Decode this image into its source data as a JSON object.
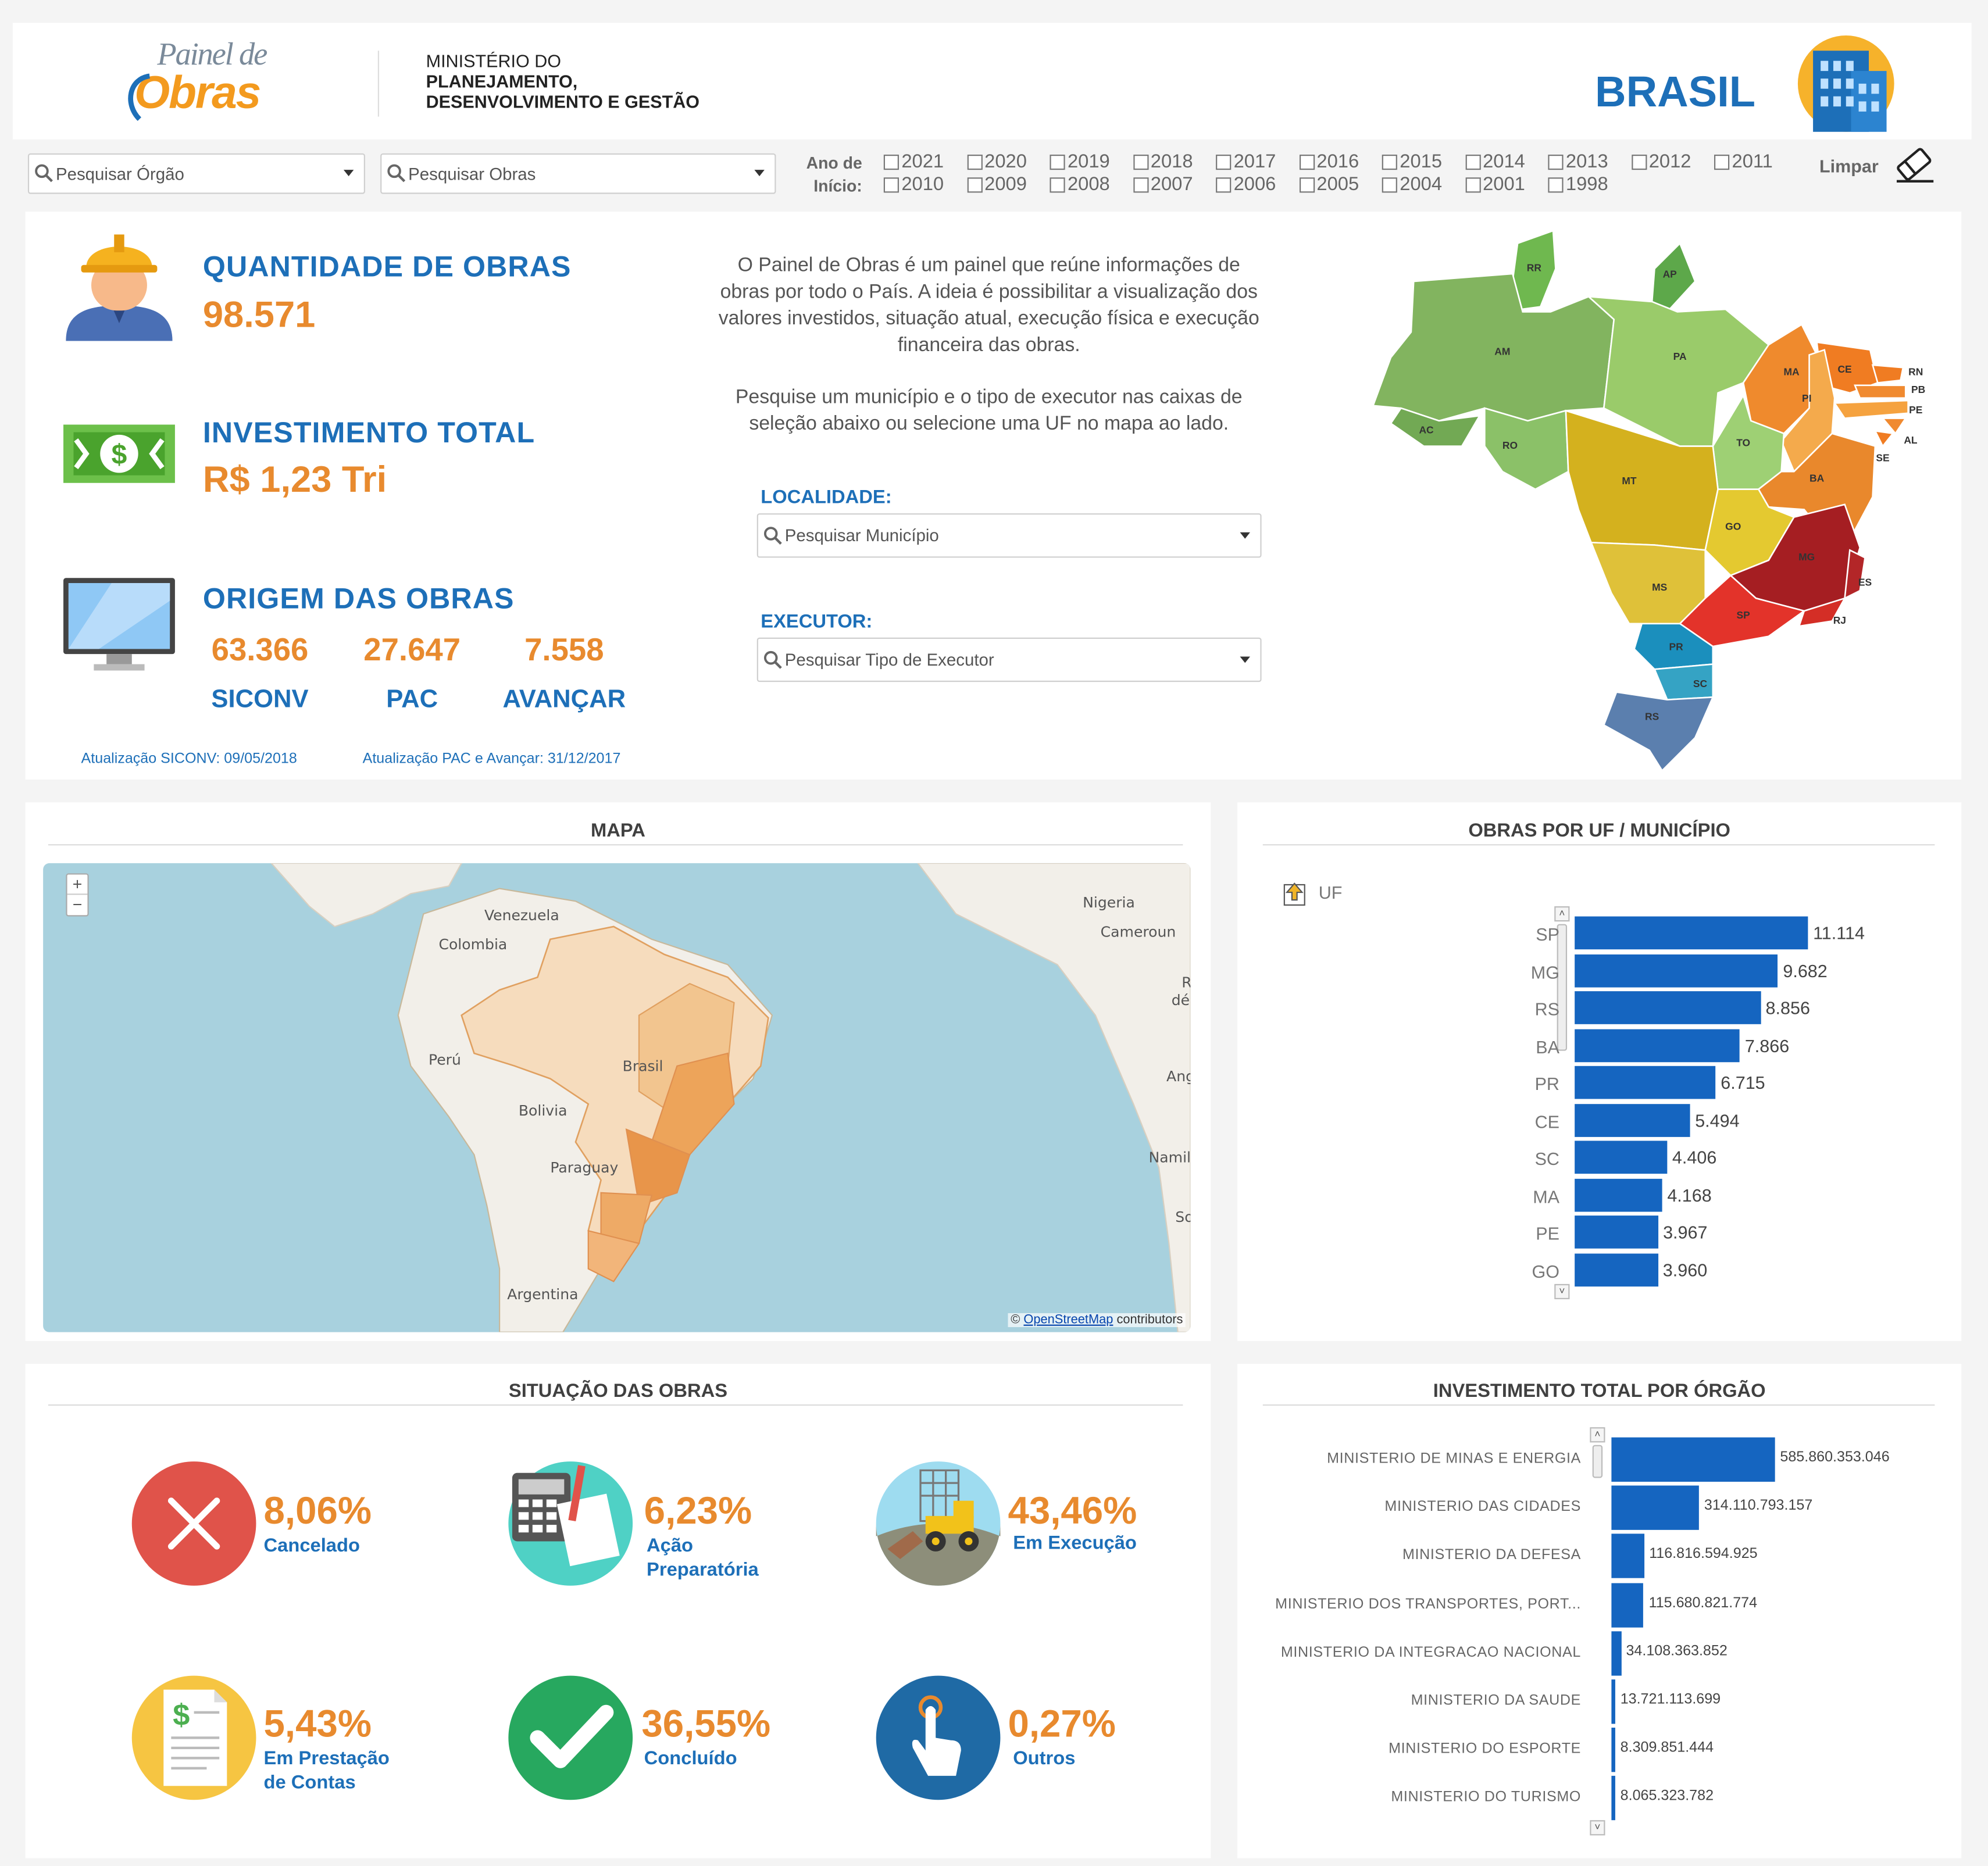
{
  "header": {
    "logo_line1": "Painel de",
    "logo_line2": "Obras",
    "ministry_line1": "MINISTÉRIO DO",
    "ministry_line2": "PLANEJAMENTO,",
    "ministry_line3": "DESENVOLVIMENTO E GESTÃO",
    "country": "BRASIL",
    "icon": "building-icon"
  },
  "filters": {
    "orgao_placeholder": "Pesquisar Órgão",
    "obras_placeholder": "Pesquisar Obras",
    "ano_label_1": "Ano de",
    "ano_label_2": "Início:",
    "years_row1": [
      "2021",
      "2020",
      "2019",
      "2018",
      "2017",
      "2016",
      "2015",
      "2014",
      "2013",
      "2012",
      "2011"
    ],
    "years_row2": [
      "2010",
      "2009",
      "2008",
      "2007",
      "2006",
      "2005",
      "2004",
      "2001",
      "1998"
    ],
    "clear_label": "Limpar"
  },
  "kpis": {
    "quantidade_title": "QUANTIDADE DE OBRAS",
    "quantidade_value": "98.571",
    "investimento_title": "INVESTIMENTO TOTAL",
    "investimento_value": "R$ 1,23 Tri",
    "origem_title": "ORIGEM DAS OBRAS",
    "origem": [
      {
        "value": "63.366",
        "label": "SICONV"
      },
      {
        "value": "27.647",
        "label": "PAC"
      },
      {
        "value": "7.558",
        "label": "AVANÇAR"
      }
    ],
    "update_siconv": "Atualização SICONV: 09/05/2018",
    "update_pac": "Atualização PAC e Avançar: 31/12/2017"
  },
  "intro": {
    "p1_l1": "O Painel de Obras é um painel que reúne informações de",
    "p1_l2": "obras por todo o País. A ideia é possibilitar a visualização dos",
    "p1_l3": "valores investidos, situação atual, execução física e execução",
    "p1_l4": "financeira das obras.",
    "p2_l1": "Pesquise um município e o tipo de executor nas caixas de",
    "p2_l2": "seleção abaixo ou selecione uma UF no mapa ao lado.",
    "localidade_label": "LOCALIDADE:",
    "localidade_placeholder": "Pesquisar Município",
    "executor_label": "EXECUTOR:",
    "executor_placeholder": "Pesquisar Tipo de Executor"
  },
  "uf_map": {
    "codes": [
      "RR",
      "AP",
      "AM",
      "PA",
      "MA",
      "CE",
      "RN",
      "PB",
      "PE",
      "AL",
      "SE",
      "PI",
      "AC",
      "RO",
      "TO",
      "MT",
      "BA",
      "GO",
      "MG",
      "ES",
      "MS",
      "SP",
      "RJ",
      "PR",
      "SC",
      "RS"
    ]
  },
  "mapa": {
    "title": "MAPA",
    "zoom_in": "+",
    "zoom_out": "−",
    "labels": [
      "Venezuela",
      "Colombia",
      "Nigeria",
      "Cameroun",
      "Perú",
      "Brasil",
      "Bolivia",
      "Paraguay",
      "Argentina",
      "Ang",
      "Namil",
      "dé",
      "So",
      "R"
    ],
    "attribution_prefix": "©",
    "attribution_link": "OpenStreetMap",
    "attribution_suffix": "contributors"
  },
  "obras_uf": {
    "title": "OBRAS POR UF / MUNICÍPIO",
    "drill_label": "UF"
  },
  "situacao": {
    "title": "SITUAÇÃO DAS OBRAS",
    "items": [
      {
        "pct": "8,06%",
        "label1": "Cancelado",
        "label2": "",
        "icon": "cancel-icon"
      },
      {
        "pct": "6,23%",
        "label1": "Ação",
        "label2": "Preparatória",
        "icon": "calculator-icon"
      },
      {
        "pct": "43,46%",
        "label1": "Em Execução",
        "label2": "",
        "icon": "construction-icon"
      },
      {
        "pct": "5,43%",
        "label1": "Em Prestação",
        "label2": "de Contas",
        "icon": "invoice-icon"
      },
      {
        "pct": "36,55%",
        "label1": "Concluído",
        "label2": "",
        "icon": "check-icon"
      },
      {
        "pct": "0,27%",
        "label1": "Outros",
        "label2": "",
        "icon": "touch-icon"
      }
    ]
  },
  "orgao": {
    "title": "INVESTIMENTO TOTAL POR ÓRGÃO"
  },
  "chart_data": [
    {
      "type": "bar",
      "orientation": "horizontal",
      "title": "OBRAS POR UF / MUNICÍPIO",
      "categories": [
        "SP",
        "MG",
        "RS",
        "BA",
        "PR",
        "CE",
        "SC",
        "MA",
        "PE",
        "GO"
      ],
      "values": [
        11114,
        9682,
        8856,
        7866,
        6715,
        5494,
        4406,
        4168,
        3967,
        3960
      ],
      "value_labels": [
        "11.114",
        "9.682",
        "8.856",
        "7.866",
        "6.715",
        "5.494",
        "4.406",
        "4.168",
        "3.967",
        "3.960"
      ],
      "color": "#1565c0"
    },
    {
      "type": "bar",
      "orientation": "horizontal",
      "title": "INVESTIMENTO TOTAL POR ÓRGÃO",
      "categories": [
        "MINISTERIO DE MINAS E ENERGIA",
        "MINISTERIO DAS CIDADES",
        "MINISTERIO DA DEFESA",
        "MINISTERIO DOS TRANSPORTES, PORT...",
        "MINISTERIO DA INTEGRACAO NACIONAL",
        "MINISTERIO DA SAUDE",
        "MINISTERIO DO ESPORTE",
        "MINISTERIO DO TURISMO"
      ],
      "values": [
        585860353046,
        314110793157,
        116816594925,
        115680821774,
        34108363852,
        13721113699,
        8309851444,
        8065323782
      ],
      "value_labels": [
        "585.860.353.046",
        "314.110.793.157",
        "116.816.594.925",
        "115.680.821.774",
        "34.108.363.852",
        "13.721.113.699",
        "8.309.851.444",
        "8.065.323.782"
      ],
      "color": "#1565c0"
    }
  ],
  "colors": {
    "blue": "#1d6fb8",
    "orange": "#e88a2e",
    "bar": "#1565c0"
  }
}
